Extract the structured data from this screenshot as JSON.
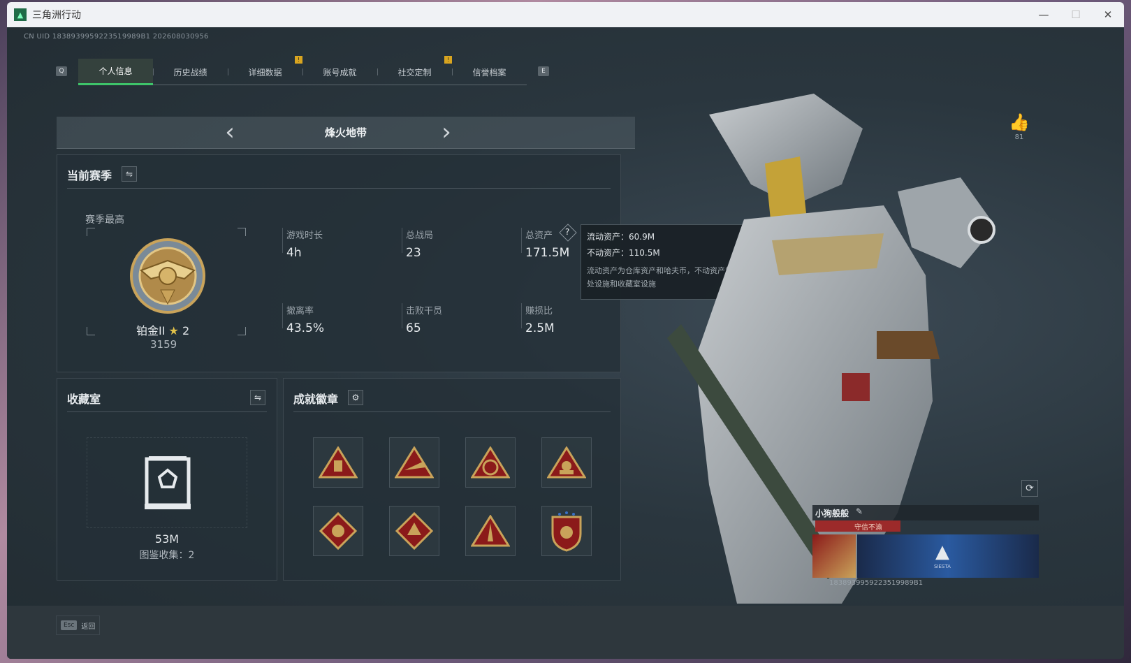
{
  "window": {
    "title": "三角洲行动",
    "minimize": "—",
    "maximize": "☐",
    "close": "✕"
  },
  "uid_text": "CN UID 1838939959223519989B1 202608030956",
  "tabs": {
    "left_key": "Q",
    "right_key": "E",
    "items": [
      {
        "label": "个人信息",
        "active": true
      },
      {
        "label": "历史战绩"
      },
      {
        "label": "详细数据",
        "alert": "!"
      },
      {
        "label": "账号成就"
      },
      {
        "label": "社交定制",
        "alert": "!"
      },
      {
        "label": "信誉档案"
      }
    ]
  },
  "mode": {
    "title": "烽火地带",
    "prev": "‹",
    "next": "›"
  },
  "season": {
    "title": "当前赛季",
    "best_label": "赛季最高",
    "rank_name": "铂金II",
    "rank_stars": "2",
    "rank_score": "3159",
    "stats": {
      "playtime_label": "游戏时长",
      "playtime": "4h",
      "matches_label": "总战局",
      "matches": "23",
      "assets_label": "总资产",
      "assets": "171.5M",
      "extract_label": "撤离率",
      "extract": "43.5%",
      "kills_label": "击败干员",
      "kills": "65",
      "profit_label": "赚损比",
      "profit": "2.5M"
    }
  },
  "tooltip": {
    "liquid": "流动资产：60.9M",
    "fixed": "不动资产：110.5M",
    "note": "流动资产为仓库资产和哈夫币，不动资产为特勤处设施和收藏室设施"
  },
  "collection": {
    "title": "收藏室",
    "value": "53M",
    "sub": "图鉴收集：2"
  },
  "achievements": {
    "title": "成就徽章",
    "count": 8
  },
  "profile": {
    "likes": "81",
    "player_name": "小狗般般",
    "player_tag": "守信不渝",
    "card_uid": "1838939959223519989B1",
    "card_logo": "SIESTA"
  },
  "bottom": {
    "esc_key": "Esc",
    "esc_label": "返回"
  },
  "colors": {
    "accent_green": "#3ec46a",
    "alert_yellow": "#d9a520",
    "medal_red": "#8b1a1a",
    "medal_gold": "#c9a35a"
  }
}
